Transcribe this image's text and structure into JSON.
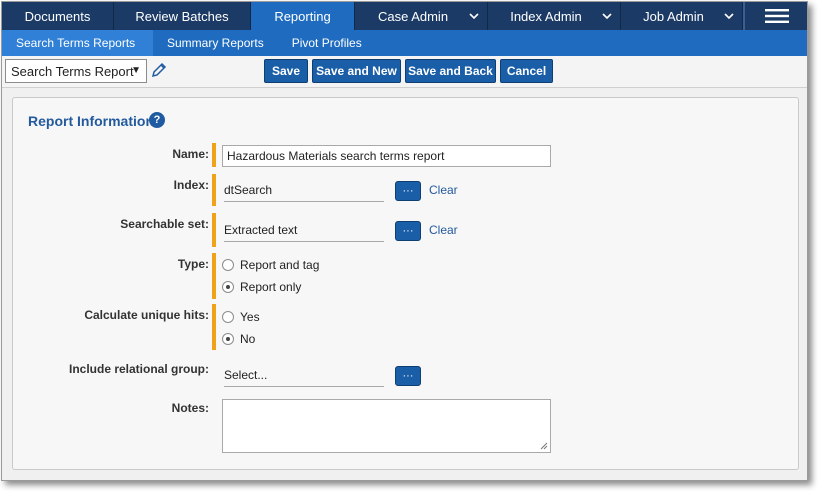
{
  "topnav": {
    "tabs": [
      {
        "label": "Documents"
      },
      {
        "label": "Review Batches"
      },
      {
        "label": "Reporting"
      },
      {
        "label": "Case Admin"
      },
      {
        "label": "Index Admin"
      },
      {
        "label": "Job Admin"
      }
    ],
    "active_tab": "Reporting"
  },
  "subnav": {
    "items": [
      {
        "label": "Search Terms Reports"
      },
      {
        "label": "Summary Reports"
      },
      {
        "label": "Pivot Profiles"
      }
    ],
    "active_item": "Search Terms Reports"
  },
  "toolbar": {
    "report_type": "Search Terms Report",
    "save_label": "Save",
    "save_new_label": "Save and New",
    "save_back_label": "Save and Back",
    "cancel_label": "Cancel"
  },
  "panel": {
    "title": "Report Information",
    "help_glyph": "?",
    "fields": {
      "name_label": "Name:",
      "name_value": "Hazardous Materials search terms report",
      "index_label": "Index:",
      "index_value": "dtSearch",
      "searchable_label": "Searchable set:",
      "searchable_value": "Extracted text",
      "type_label": "Type:",
      "type_options": [
        "Report and tag",
        "Report only"
      ],
      "type_selected": "Report only",
      "unique_label": "Calculate unique hits:",
      "unique_options": [
        "Yes",
        "No"
      ],
      "unique_selected": "No",
      "relational_label": "Include relational group:",
      "relational_value": "Select...",
      "notes_label": "Notes:",
      "notes_value": ""
    },
    "picker_glyph": "···",
    "clear_label": "Clear"
  },
  "colors": {
    "nav_dark": "#1b3a66",
    "nav_active": "#1e6bbf",
    "button": "#1a5ea8",
    "required_marker": "#f0a21b",
    "title_blue": "#235a9e"
  }
}
